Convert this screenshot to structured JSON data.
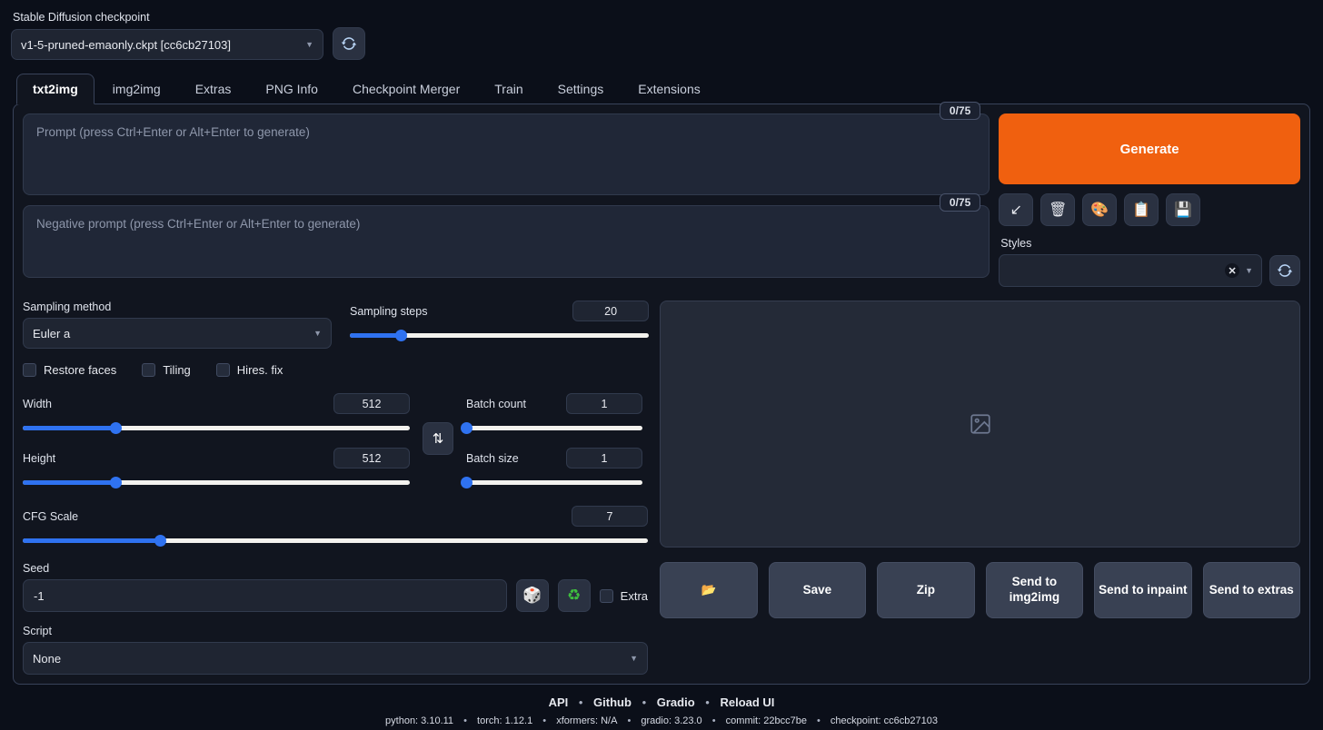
{
  "checkpoint": {
    "label": "Stable Diffusion checkpoint",
    "value": "v1-5-pruned-emaonly.ckpt [cc6cb27103]",
    "refresh_icon": "refresh-icon"
  },
  "tabs": [
    {
      "label": "txt2img",
      "active": true
    },
    {
      "label": "img2img",
      "active": false
    },
    {
      "label": "Extras",
      "active": false
    },
    {
      "label": "PNG Info",
      "active": false
    },
    {
      "label": "Checkpoint Merger",
      "active": false
    },
    {
      "label": "Train",
      "active": false
    },
    {
      "label": "Settings",
      "active": false
    },
    {
      "label": "Extensions",
      "active": false
    }
  ],
  "prompt": {
    "placeholder": "Prompt (press Ctrl+Enter or Alt+Enter to generate)",
    "value": "",
    "token_count": "0/75"
  },
  "negative_prompt": {
    "placeholder": "Negative prompt (press Ctrl+Enter or Alt+Enter to generate)",
    "value": "",
    "token_count": "0/75"
  },
  "generate": {
    "label": "Generate",
    "color": "#f0600f",
    "tool_icons": [
      {
        "name": "restore-progress-icon",
        "glyph": "↙"
      },
      {
        "name": "clear-prompt-trash-icon",
        "glyph": "🗑"
      },
      {
        "name": "apply-style-paint-icon",
        "glyph": "🎨"
      },
      {
        "name": "paste-clipboard-icon",
        "glyph": "📋"
      },
      {
        "name": "save-style-floppy-icon",
        "glyph": "💾"
      }
    ]
  },
  "styles": {
    "label": "Styles",
    "value": "",
    "clear_glyph": "✕",
    "refresh_icon": "refresh-icon"
  },
  "settings": {
    "sampling_method": {
      "label": "Sampling method",
      "value": "Euler a"
    },
    "sampling_steps": {
      "label": "Sampling steps",
      "value": "20",
      "percent": 17
    },
    "checkboxes": [
      {
        "label": "Restore faces",
        "checked": false
      },
      {
        "label": "Tiling",
        "checked": false
      },
      {
        "label": "Hires. fix",
        "checked": false
      }
    ],
    "width": {
      "label": "Width",
      "value": "512",
      "percent": 24
    },
    "height": {
      "label": "Height",
      "value": "512",
      "percent": 24
    },
    "batch_count": {
      "label": "Batch count",
      "value": "1",
      "percent": 0
    },
    "batch_size": {
      "label": "Batch size",
      "value": "1",
      "percent": 0
    },
    "cfg_scale": {
      "label": "CFG Scale",
      "value": "7",
      "percent": 22
    },
    "swap_icon": {
      "name": "swap-dimensions-icon",
      "glyph": "⇅"
    },
    "seed": {
      "label": "Seed",
      "value": "-1",
      "dice_icon": {
        "name": "random-seed-dice-icon",
        "glyph": "🎲"
      },
      "recycle_icon": {
        "name": "reuse-seed-recycle-icon",
        "glyph": "♻"
      },
      "extra_label": "Extra",
      "extra_checked": false
    },
    "script": {
      "label": "Script",
      "value": "None"
    }
  },
  "result": {
    "placeholder_icon": "image-placeholder-icon",
    "actions": [
      {
        "name": "open-folder-button",
        "label": "",
        "glyph": "📂"
      },
      {
        "name": "save-button",
        "label": "Save",
        "glyph": ""
      },
      {
        "name": "zip-button",
        "label": "Zip",
        "glyph": ""
      },
      {
        "name": "send-to-img2img-button",
        "label": "Send to img2img",
        "glyph": ""
      },
      {
        "name": "send-to-inpaint-button",
        "label": "Send to inpaint",
        "glyph": ""
      },
      {
        "name": "send-to-extras-button",
        "label": "Send to extras",
        "glyph": ""
      }
    ]
  },
  "footer": {
    "links": [
      "API",
      "Github",
      "Gradio",
      "Reload UI"
    ],
    "separator": "•",
    "versions": [
      "python: 3.10.11",
      "torch: 1.12.1",
      "xformers: N/A",
      "gradio: 3.23.0",
      "commit: 22bcc7be",
      "checkpoint: cc6cb27103"
    ]
  }
}
